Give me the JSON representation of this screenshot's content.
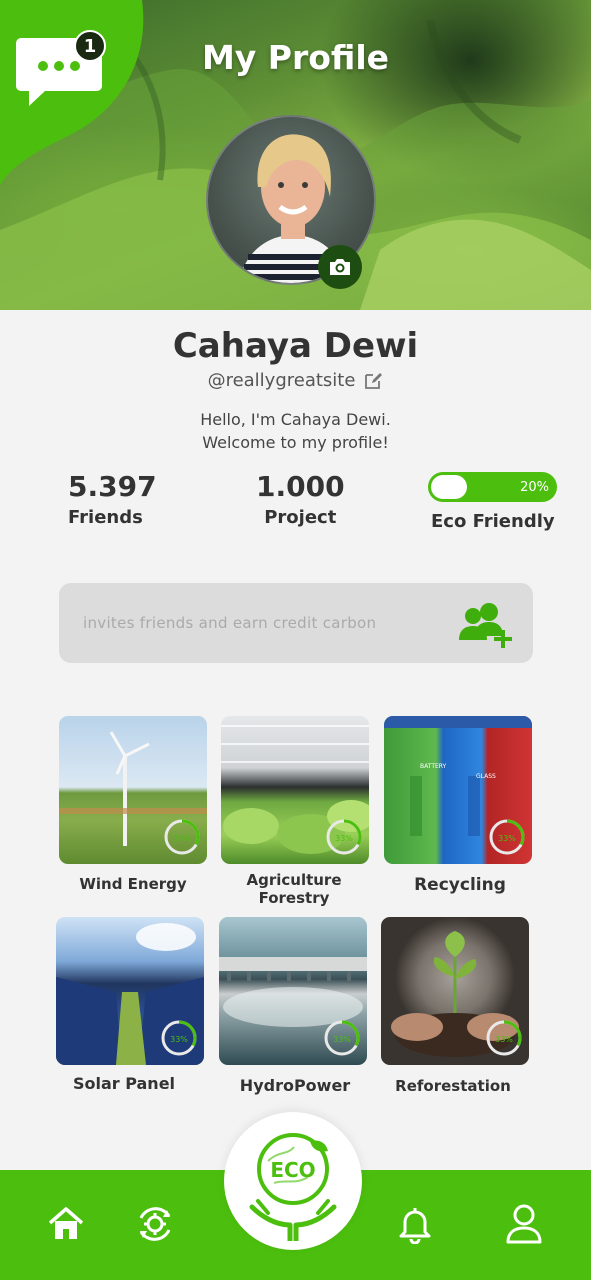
{
  "header": {
    "title": "My Profile",
    "notification_count": "1"
  },
  "profile": {
    "name": "Cahaya Dewi",
    "handle": "@reallygreatsite",
    "bio_line1": "Hello, I'm Cahaya Dewi.",
    "bio_line2": "Welcome to my profile!"
  },
  "stats": {
    "friends_value": "5.397",
    "friends_label": "Friends",
    "project_value": "1.000",
    "project_label": "Project",
    "eco_label": "Eco Friendly",
    "eco_percent_text": "20%",
    "eco_progress": 0.2
  },
  "invite": {
    "text": "invites friends  and earn credit carbon"
  },
  "categories": [
    {
      "label": "Wind Energy",
      "progress_text": "33%",
      "progress": 0.33
    },
    {
      "label_line1": "Agriculture",
      "label_line2": "Forestry",
      "progress_text": "33%",
      "progress": 0.33
    },
    {
      "label": "Recycling",
      "progress_text": "33%",
      "progress": 0.33
    },
    {
      "label": "Solar Panel",
      "progress_text": "33%",
      "progress": 0.33
    },
    {
      "label": "HydroPower",
      "progress_text": "33%",
      "progress": 0.33
    },
    {
      "label": "Reforestation",
      "progress_text": "33%",
      "progress": 0.33
    }
  ],
  "recycling_bins": [
    "BATTERY",
    "GLASS"
  ],
  "bottom_nav": {
    "eco_logo_text": "ECO",
    "items": [
      "home-icon",
      "recycle-settings-icon",
      "eco-logo",
      "bell-icon",
      "user-icon"
    ]
  },
  "colors": {
    "accent": "#4cbf0e",
    "dark_green": "#1e4d12",
    "text": "#333333",
    "invite_bg": "#dcdcdc"
  }
}
